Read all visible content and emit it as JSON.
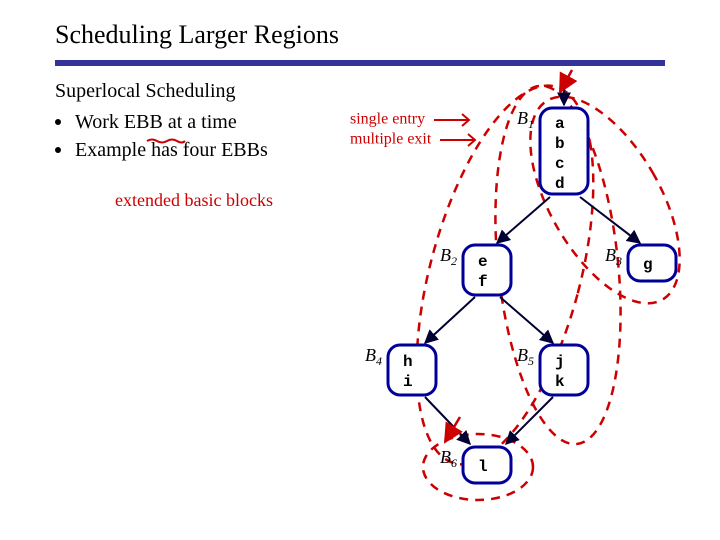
{
  "title": "Scheduling Larger Regions",
  "subtitle": "Superlocal Scheduling",
  "bullets": [
    "Work EBB at a time",
    "Example has four EBBs"
  ],
  "annotations": {
    "extended": "extended basic blocks",
    "single_entry": "single entry",
    "multiple_exit": "multiple exit"
  },
  "blocks": {
    "B1": {
      "label": "B",
      "sub": "1",
      "lines": [
        "a",
        "b",
        "c",
        "d"
      ]
    },
    "B2": {
      "label": "B",
      "sub": "2",
      "lines": [
        "e",
        "f"
      ]
    },
    "B3": {
      "label": "B",
      "sub": "3",
      "lines": [
        "g"
      ]
    },
    "B4": {
      "label": "B",
      "sub": "4",
      "lines": [
        "h",
        "i"
      ]
    },
    "B5": {
      "label": "B",
      "sub": "5",
      "lines": [
        "j",
        "k"
      ]
    },
    "B6": {
      "label": "B",
      "sub": "6",
      "lines": [
        "l"
      ]
    }
  },
  "chart_data": {
    "type": "diagram",
    "title": "Control-flow graph with extended basic blocks",
    "nodes": [
      {
        "id": "B1",
        "code": [
          "a",
          "b",
          "c",
          "d"
        ]
      },
      {
        "id": "B2",
        "code": [
          "e",
          "f"
        ]
      },
      {
        "id": "B3",
        "code": [
          "g"
        ]
      },
      {
        "id": "B4",
        "code": [
          "h",
          "i"
        ]
      },
      {
        "id": "B5",
        "code": [
          "j",
          "k"
        ]
      },
      {
        "id": "B6",
        "code": [
          "l"
        ]
      }
    ],
    "edges": [
      [
        "entry",
        "B1"
      ],
      [
        "B1",
        "B2"
      ],
      [
        "B1",
        "B3"
      ],
      [
        "B2",
        "B4"
      ],
      [
        "B2",
        "B5"
      ],
      [
        "B4",
        "B6"
      ],
      [
        "B5",
        "B6"
      ]
    ],
    "ebbs": [
      [
        "B1",
        "B2",
        "B4"
      ],
      [
        "B1",
        "B2",
        "B5"
      ],
      [
        "B1",
        "B3"
      ],
      [
        "B6"
      ]
    ],
    "annotations": [
      "single entry",
      "multiple exit",
      "extended basic blocks"
    ]
  }
}
